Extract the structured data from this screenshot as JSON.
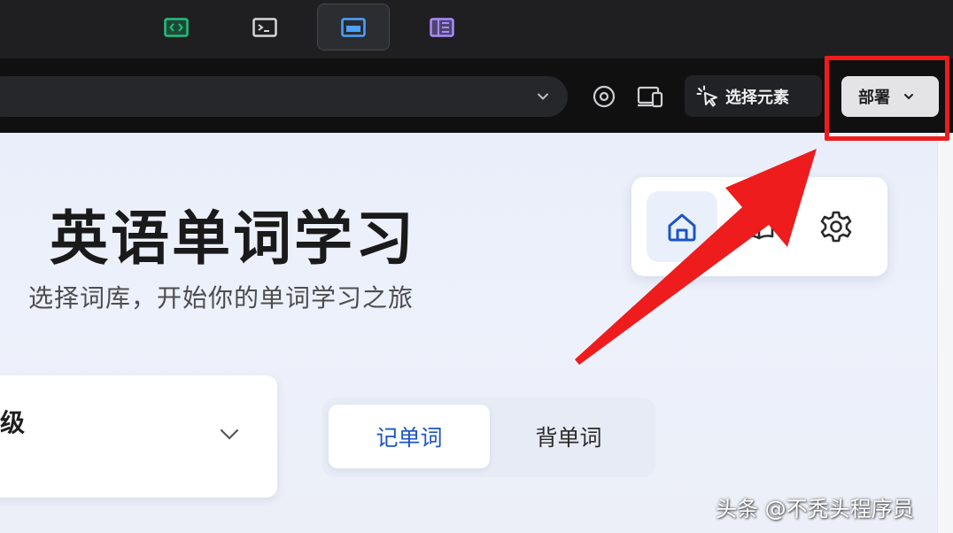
{
  "tabs": [
    {
      "icon": "code-tag-icon",
      "color": "#21c07a"
    },
    {
      "icon": "terminal-icon",
      "color": "#d7d7d7"
    },
    {
      "icon": "preview-window-icon",
      "color": "#4aa3ff",
      "active": true
    },
    {
      "icon": "panel-layout-icon",
      "color": "#a98bff"
    }
  ],
  "toolbar": {
    "url_value": "",
    "select_element_label": "选择元素",
    "deploy_label": "部署",
    "icons": [
      "compass-icon",
      "device-preview-icon",
      "cursor-select-icon",
      "chevron-down-icon"
    ]
  },
  "page": {
    "title": "英语单词学习",
    "subtitle": "选择词库，开始你的单词学习之旅"
  },
  "nav": {
    "items": [
      "home-icon",
      "book-icon",
      "gear-icon"
    ],
    "active": "home-icon",
    "accent": "#1b55c4"
  },
  "level_select": {
    "value": "级"
  },
  "modes": {
    "items": [
      {
        "label": "记单词",
        "active": true
      },
      {
        "label": "背单词",
        "active": false
      }
    ]
  },
  "watermark": "头条 @不秃头程序员",
  "annotation": {
    "color": "#ee1c1c"
  }
}
